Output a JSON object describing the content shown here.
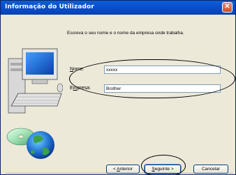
{
  "window": {
    "title": "Informação do Utilizador"
  },
  "instructions": "Escreva o seu nome e o nome da empresa onde trabalha.",
  "form": {
    "name_label_underlined": "N",
    "name_label_rest": "ome:",
    "name_value": "xxxxx",
    "company_label_first": "E",
    "company_label_underlined": "m",
    "company_label_rest": "presa:",
    "company_value": "Brother"
  },
  "buttons": {
    "back_underlined": "A",
    "back_before": "< ",
    "back_after": "nterior",
    "next_underlined": "S",
    "next_after": "eguinte >",
    "cancel": "Cancelar"
  },
  "icons": {
    "close": "close-icon",
    "computer": "computer-illustration",
    "cd": "cd-icon",
    "globe": "globe-icon"
  },
  "colors": {
    "titlebar": "#0b4fc9",
    "close": "#d1492b",
    "dialog_bg": "#ece9d8",
    "input_border": "#7f9db9"
  }
}
